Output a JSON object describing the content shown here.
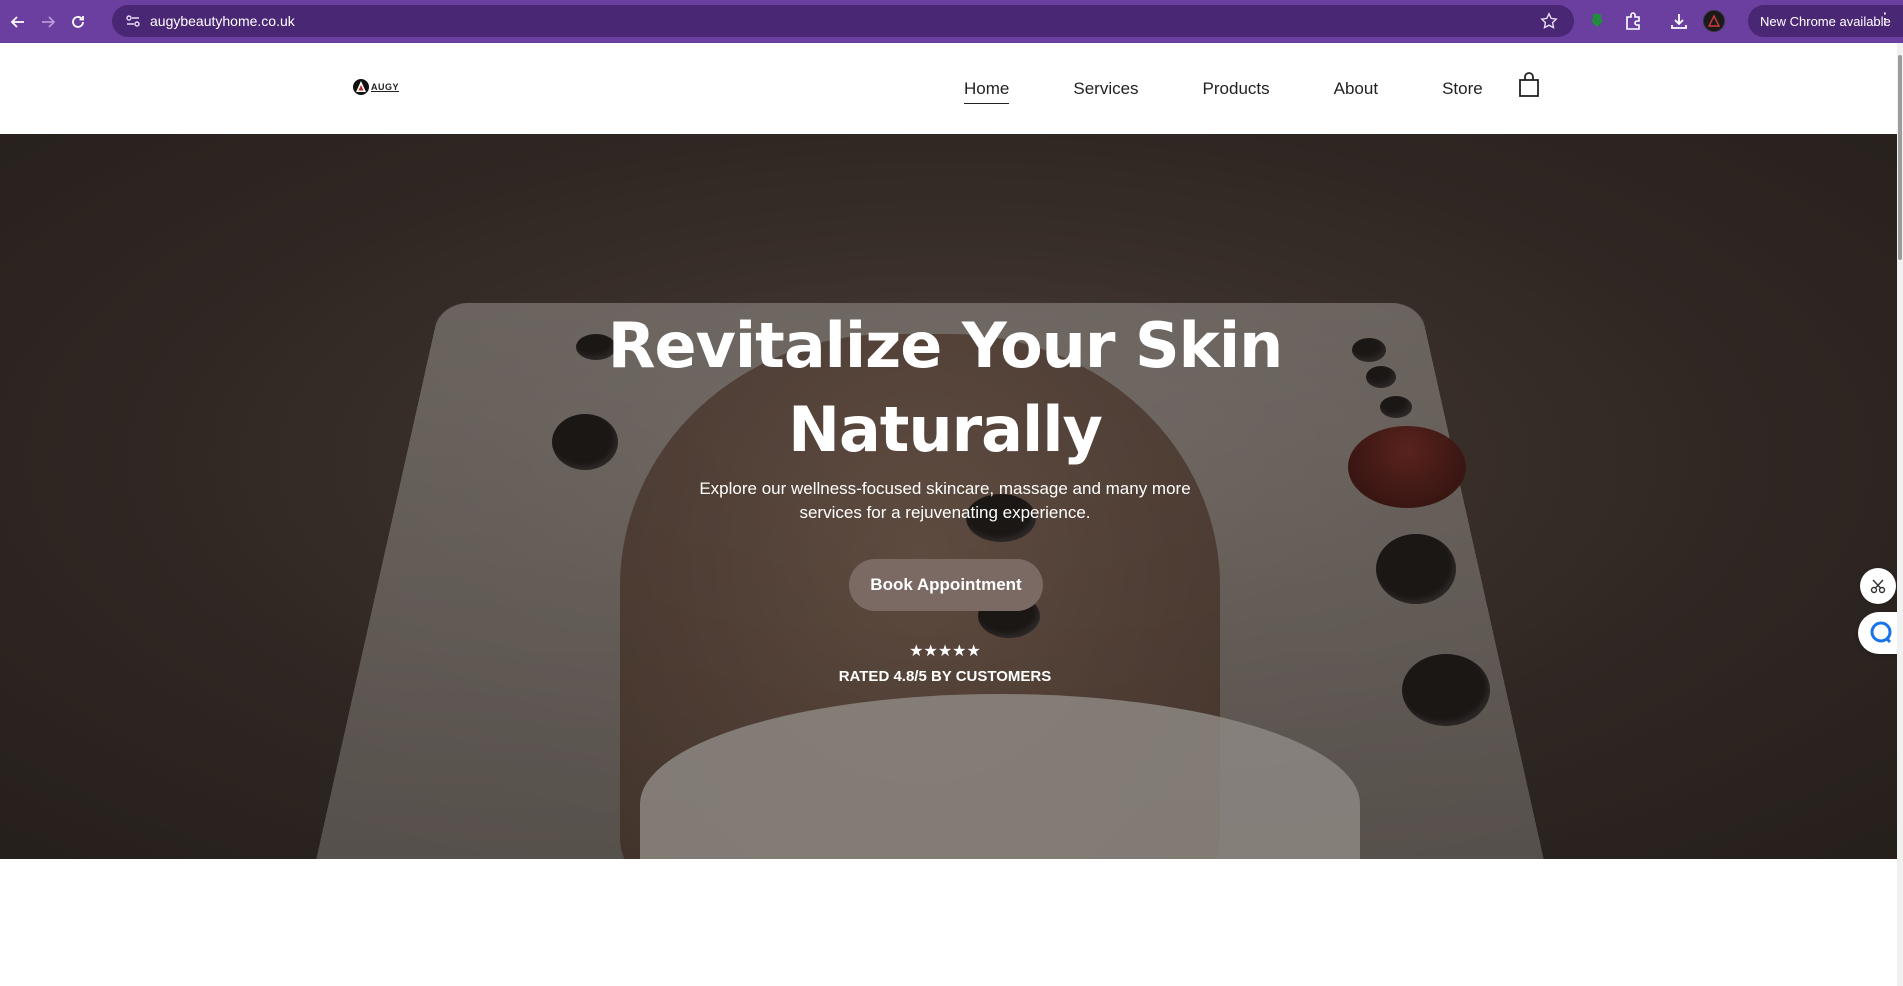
{
  "browser": {
    "url": "augybeautyhome.co.uk",
    "update_label": "New Chrome available"
  },
  "site": {
    "logo_text": "AUGY",
    "nav": [
      {
        "label": "Home",
        "active": true
      },
      {
        "label": "Services",
        "active": false
      },
      {
        "label": "Products",
        "active": false
      },
      {
        "label": "About",
        "active": false
      },
      {
        "label": "Store",
        "active": false
      }
    ]
  },
  "hero": {
    "title_line1": "Revitalize Your Skin",
    "title_line2": "Naturally",
    "subtitle": "Explore our wellness-focused skincare, massage and many more services for a rejuvenating experience.",
    "cta_label": "Book Appointment",
    "rating_stars": "★★★★★",
    "rating_text": "RATED 4.8/5 BY CUSTOMERS",
    "cta_color": "#7b6a63"
  },
  "theme": {
    "chrome_color": "#6b3fa0",
    "omnibox_color": "#4a2774"
  }
}
